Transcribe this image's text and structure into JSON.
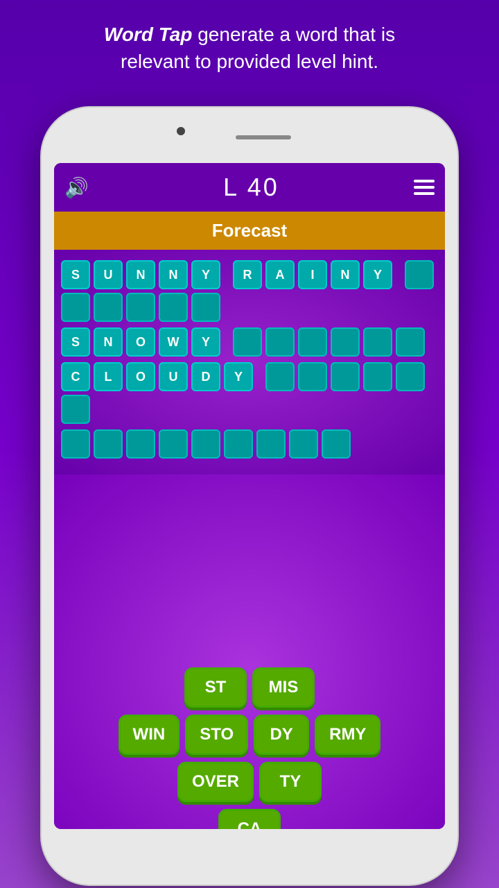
{
  "header": {
    "bold_part": "Word Tap",
    "rest_text": " generate a word that is relevant to provided level hint."
  },
  "game": {
    "level_label": "L  40",
    "category": "Forecast",
    "words": [
      {
        "id": "sunny",
        "letters": [
          "S",
          "U",
          "N",
          "N",
          "Y"
        ],
        "solved": true,
        "extra_tiles": 6
      },
      {
        "id": "rainy",
        "letters": [
          "R",
          "A",
          "I",
          "N",
          "Y"
        ],
        "solved": true,
        "extra_tiles": 0
      },
      {
        "id": "row1_empty",
        "extra_tiles": 6
      },
      {
        "id": "snowy",
        "letters": [
          "S",
          "N",
          "O",
          "W",
          "Y"
        ],
        "solved": true,
        "extra_tiles": 6
      },
      {
        "id": "cloudy",
        "letters": [
          "C",
          "L",
          "O",
          "U",
          "D",
          "Y"
        ],
        "solved": true,
        "extra_tiles": 6
      },
      {
        "id": "row4",
        "extra_tiles": 9
      }
    ],
    "buttons": [
      {
        "row": 1,
        "buttons": [
          {
            "label": "ST"
          },
          {
            "label": "MIS"
          }
        ]
      },
      {
        "row": 2,
        "buttons": [
          {
            "label": "WIN"
          },
          {
            "label": "STO"
          },
          {
            "label": "DY"
          },
          {
            "label": "RMY"
          }
        ]
      },
      {
        "row": 3,
        "buttons": [
          {
            "label": "OVER"
          },
          {
            "label": "TY"
          }
        ]
      },
      {
        "row": 4,
        "buttons": [
          {
            "label": "CA"
          }
        ]
      }
    ]
  }
}
